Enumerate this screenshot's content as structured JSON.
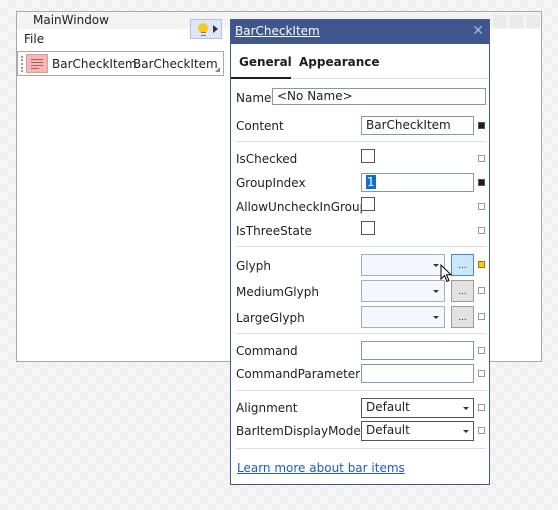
{
  "main_window": {
    "title": "MainWindow",
    "menu": [
      "File"
    ],
    "toolbar": {
      "item_icon": "check-item-icon",
      "item_labels": [
        "BarCheckItem",
        "BarCheckItem"
      ]
    }
  },
  "smart_tag": {
    "icon": "lightbulb-icon",
    "arrow_icon": "triangle-right-icon"
  },
  "panel": {
    "title": "BarCheckItem",
    "close_icon": "close-icon",
    "tabs": [
      {
        "label": "General",
        "active": true
      },
      {
        "label": "Appearance",
        "active": false
      }
    ],
    "name_label": "Name",
    "name_value": "<No Name>",
    "properties": {
      "content": {
        "label": "Content",
        "value": "BarCheckItem",
        "marker": "set"
      },
      "is_checked": {
        "label": "IsChecked",
        "checked": false,
        "marker": "default"
      },
      "group_index": {
        "label": "GroupIndex",
        "value": "1",
        "marker": "set"
      },
      "allow_uncheck_in_group": {
        "label": "AllowUncheckInGroup",
        "checked": false,
        "marker": "default"
      },
      "is_three_state": {
        "label": "IsThreeState",
        "checked": false,
        "marker": "default"
      },
      "glyph": {
        "label": "Glyph",
        "value": "",
        "button": "...",
        "marker": "resource"
      },
      "medium_glyph": {
        "label": "MediumGlyph",
        "value": "",
        "button": "...",
        "marker": "default"
      },
      "large_glyph": {
        "label": "LargeGlyph",
        "value": "",
        "button": "...",
        "marker": "default"
      },
      "command": {
        "label": "Command",
        "value": "",
        "marker": "default"
      },
      "command_parameter": {
        "label": "CommandParameter",
        "value": "",
        "marker": "default"
      },
      "alignment": {
        "label": "Alignment",
        "value": "Default",
        "marker": "default"
      },
      "bar_item_display_mode": {
        "label": "BarItemDisplayMode",
        "value": "Default",
        "marker": "default"
      }
    },
    "learn_more_link": "Learn more about bar items"
  },
  "colors": {
    "panel_header": "#3f568f",
    "check_item_bg": "#f7b5b5",
    "link": "#1f5bc6",
    "marker_resource": "#f8c91a",
    "selection": "#0f6fd0"
  }
}
